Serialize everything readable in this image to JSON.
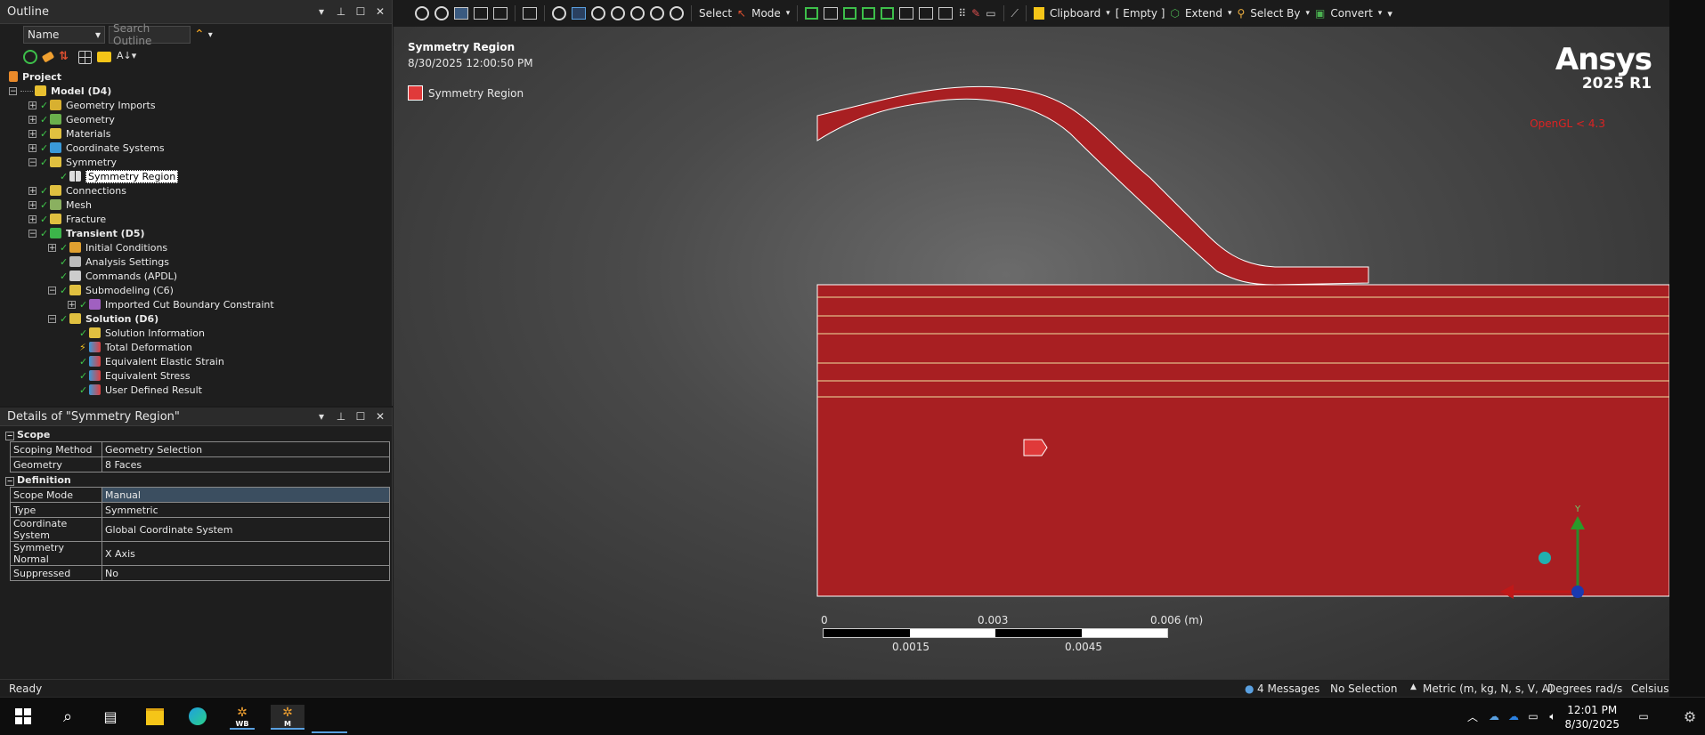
{
  "outline": {
    "title": "Outline",
    "filter_select": "Name",
    "search_placeholder": "Search Outline",
    "tree": [
      {
        "label": "Project",
        "bold": true
      },
      {
        "label": "Model (D4)",
        "bold": true
      },
      {
        "label": "Geometry Imports"
      },
      {
        "label": "Geometry"
      },
      {
        "label": "Materials"
      },
      {
        "label": "Coordinate Systems"
      },
      {
        "label": "Symmetry"
      },
      {
        "label": "Symmetry Region"
      },
      {
        "label": "Connections"
      },
      {
        "label": "Mesh"
      },
      {
        "label": "Fracture"
      },
      {
        "label": "Transient (D5)",
        "bold": true
      },
      {
        "label": "Initial Conditions"
      },
      {
        "label": "Analysis Settings"
      },
      {
        "label": "Commands (APDL)"
      },
      {
        "label": "Submodeling (C6)"
      },
      {
        "label": "Imported Cut Boundary Constraint"
      },
      {
        "label": "Solution (D6)",
        "bold": true
      },
      {
        "label": "Solution Information"
      },
      {
        "label": "Total Deformation"
      },
      {
        "label": "Equivalent Elastic Strain"
      },
      {
        "label": "Equivalent Stress"
      },
      {
        "label": "User Defined Result"
      }
    ]
  },
  "details": {
    "title": "Details of \"Symmetry Region\"",
    "sections": [
      {
        "name": "Scope",
        "rows": [
          {
            "key": "Scoping Method",
            "value": "Geometry Selection"
          },
          {
            "key": "Geometry",
            "value": "8 Faces"
          }
        ]
      },
      {
        "name": "Definition",
        "rows": [
          {
            "key": "Scope Mode",
            "value": "Manual"
          },
          {
            "key": "Type",
            "value": "Symmetric"
          },
          {
            "key": "Coordinate System",
            "value": "Global Coordinate System"
          },
          {
            "key": "Symmetry Normal",
            "value": "X Axis"
          },
          {
            "key": "Suppressed",
            "value": "No"
          }
        ]
      }
    ]
  },
  "toolbar": {
    "select_label": "Select",
    "mode_label": "Mode",
    "clipboard_label": "Clipboard",
    "empty_label": "[ Empty ]",
    "extend_label": "Extend",
    "select_by_label": "Select By",
    "convert_label": "Convert"
  },
  "viewport": {
    "title": "Symmetry Region",
    "timestamp": "8/30/2025 12:00:50 PM",
    "legend_label": "Symmetry Region",
    "brand": "Ansys",
    "version": "2025 R1",
    "opengl": "OpenGL < 4.3",
    "scale_top": [
      "0",
      "0.003",
      "0.006 (m)"
    ],
    "scale_bottom": [
      "0.0015",
      "0.0045"
    ],
    "triad_y_label": "Y",
    "body_color": "#a81f22"
  },
  "status": {
    "ready": "Ready",
    "messages": "4 Messages",
    "selection": "No Selection",
    "units": "Metric (m, kg, N, s, V, A)",
    "angle": "Degrees",
    "rate": "rad/s",
    "temp": "Celsius"
  },
  "taskbar": {
    "wb_label": "WB",
    "m_label": "M",
    "time": "12:01 PM",
    "date": "8/30/2025"
  }
}
